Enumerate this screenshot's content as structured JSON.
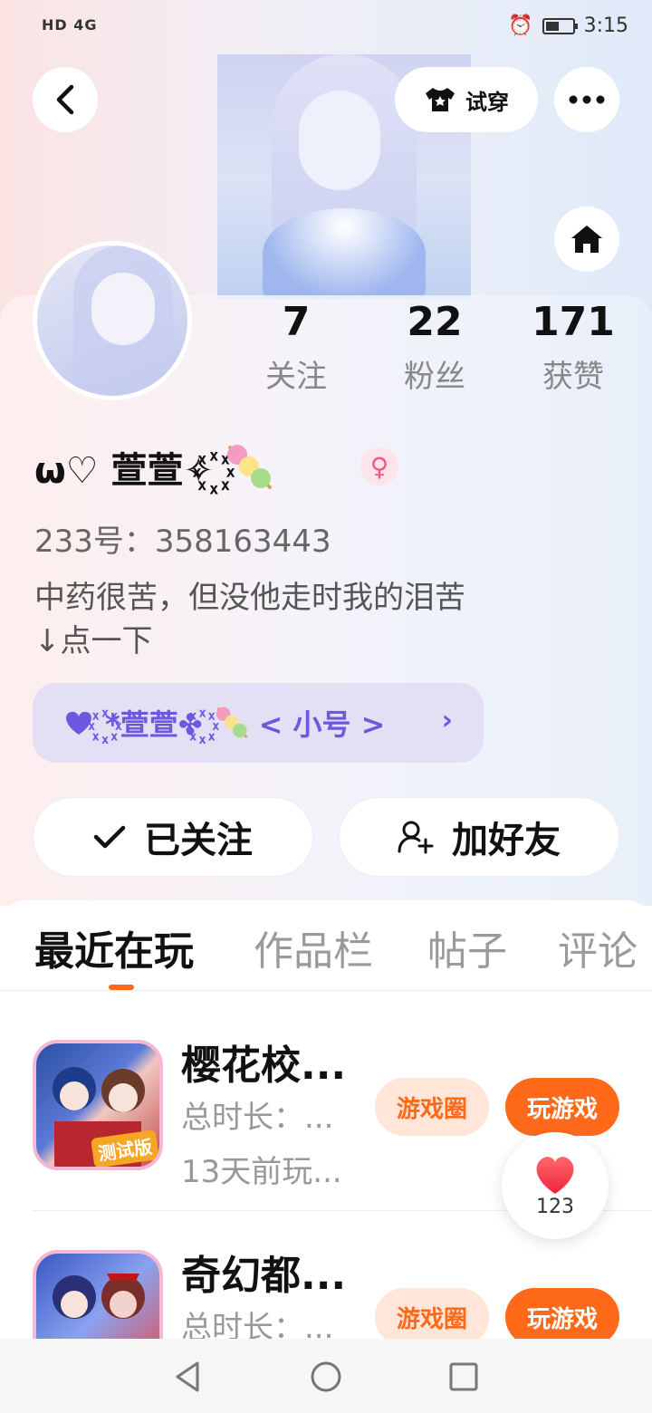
{
  "status_bar": {
    "left_text": "HD 4G",
    "time": "3:15"
  },
  "header": {
    "back_icon": "back-arrow-icon",
    "try_on_label": "试穿",
    "more_icon": "more-dots-icon",
    "home_icon": "home-icon"
  },
  "profile": {
    "name": "ω♡ 萱萱✧꙰",
    "gender": "♀",
    "uid_label": "233号：358163443",
    "bio_line1": "中药很苦，但没他走时我的泪苦",
    "bio_line2": "↓点一下",
    "alt_account_text": "꙰*萱萱✤꙰",
    "alt_account_tag": "< 小号 >",
    "alt_chevron": "›"
  },
  "stats": [
    {
      "value": "7",
      "label": "关注"
    },
    {
      "value": "22",
      "label": "粉丝"
    },
    {
      "value": "171",
      "label": "获赞"
    }
  ],
  "actions": {
    "followed_label": "已关注",
    "add_friend_label": "加好友"
  },
  "tabs": [
    "最近在玩",
    "作品栏",
    "帖子",
    "评论"
  ],
  "games": [
    {
      "title": "樱花校...",
      "duration": "总时长：...",
      "last_played": "13天前玩...",
      "icon_badge": "测试版",
      "circle_label": "游戏圈",
      "play_label": "玩游戏"
    },
    {
      "title": "奇幻都...",
      "duration": "总时长：...",
      "circle_label": "游戏圈",
      "play_label": "玩游戏"
    }
  ],
  "like_float": {
    "count": "123"
  },
  "colors": {
    "accent": "#ff6a1a",
    "purple": "#6e58e0",
    "gender_pink": "#ef5a88"
  }
}
